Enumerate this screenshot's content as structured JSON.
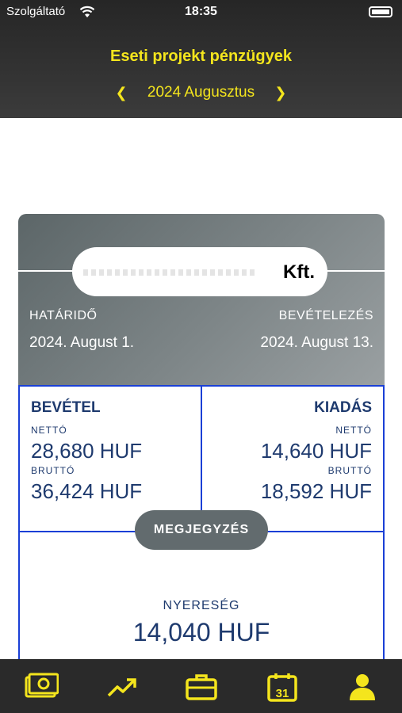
{
  "status_bar": {
    "carrier": "Szolgáltató",
    "time": "18:35"
  },
  "header": {
    "title": "Eseti projekt pénzügyek",
    "month": "2024 Augusztus"
  },
  "card": {
    "company_suffix": "Kft.",
    "deadline_label": "HATÁRIDŐ",
    "deadline_value": "2024. August 1.",
    "collection_label": "BEVÉTELEZÉS",
    "collection_value": "2024. August 13."
  },
  "income": {
    "title": "BEVÉTEL",
    "net_label": "NETTÓ",
    "net_value": "28,680 HUF",
    "gross_label": "BRUTTÓ",
    "gross_value": "36,424 HUF"
  },
  "expense": {
    "title": "KIADÁS",
    "net_label": "NETTÓ",
    "net_value": "14,640 HUF",
    "gross_label": "BRUTTÓ",
    "gross_value": "18,592 HUF"
  },
  "note_button": "MEGJEGYZÉS",
  "profit": {
    "label": "NYERESÉG",
    "value": "14,040 HUF"
  },
  "colors": {
    "accent": "#f4e51d",
    "navy": "#1e3a6e",
    "border_blue": "#1a3fd6"
  },
  "tabs": [
    {
      "icon": "money-icon"
    },
    {
      "icon": "trend-icon"
    },
    {
      "icon": "briefcase-icon"
    },
    {
      "icon": "calendar-icon",
      "text": "31"
    },
    {
      "icon": "person-icon"
    }
  ]
}
